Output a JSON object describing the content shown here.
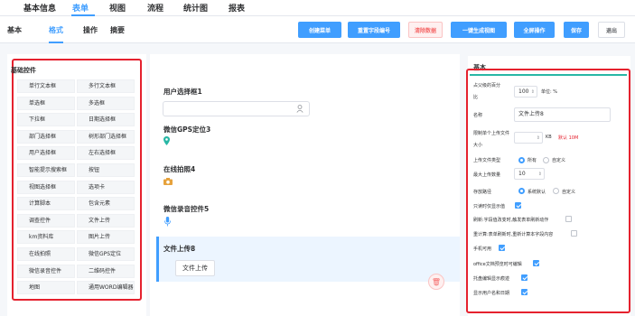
{
  "top_tabs": [
    "基本信息",
    "表单",
    "视图",
    "流程",
    "统计图",
    "报表"
  ],
  "sub_tabs": [
    "基本",
    "格式",
    "操作",
    "摘要"
  ],
  "toolbar": {
    "create_menu": "创建菜单",
    "reset_field_no": "重置字段编号",
    "clear_data": "清除数据",
    "generate_view": "一键生成视图",
    "fullscreen": "全屏操作",
    "save": "保存",
    "exit": "退出"
  },
  "left_panel": {
    "title": "基础控件",
    "items": [
      "单行文本框",
      "多行文本框",
      "单选框",
      "多选框",
      "下拉框",
      "日期选择框",
      "部门选择框",
      "树形部门选择框",
      "用户选择框",
      "左右选择框",
      "智能提示搜索框",
      "按钮",
      "视图选择框",
      "选项卡",
      "计算脚本",
      "包含元素",
      "调查控件",
      "文件上传",
      "km资料库",
      "图片上传",
      "在线拍照",
      "微信GPS定位",
      "微信录音控件",
      "二维码控件",
      "地图",
      "通用WORD编辑器"
    ]
  },
  "canvas": {
    "user_select_label": "用户选择框1",
    "gps_label": "微信GPS定位3",
    "photo_label": "在线拍照4",
    "record_label": "微信录音控件5",
    "file_label": "文件上传8",
    "upload_button": "文件上传"
  },
  "right_panel": {
    "title": "基本",
    "pct_label": "占父级的百分比",
    "pct_value": "100",
    "unit_label": "单位: %",
    "name_label": "名称",
    "name_value": "文件上传8",
    "maxsize_label": "限制单个上传文件大小",
    "maxsize_unit": "KB",
    "maxsize_default": "默认 10M",
    "filetype_label": "上传文件类型",
    "filetype_opt1": "所有",
    "filetype_opt2": "自定义",
    "maxcount_label": "最大上传数量",
    "maxcount_value": "10",
    "storage_label": "存放路径",
    "storage_opt1": "系统默认",
    "storage_opt2": "自定义",
    "readonly_label": "只读时仅显示值",
    "refresh_label": "刷新:字段值改变时,触发表单刷新动作",
    "recalc_label": "重计算:表单刷新时,重新计算本字段内容",
    "mobile_label": "手机可用",
    "office_label": "office文档预览时可编辑",
    "online_label": "托盘编辑显示痕迹",
    "showuser_label": "显示用户名和日期"
  }
}
